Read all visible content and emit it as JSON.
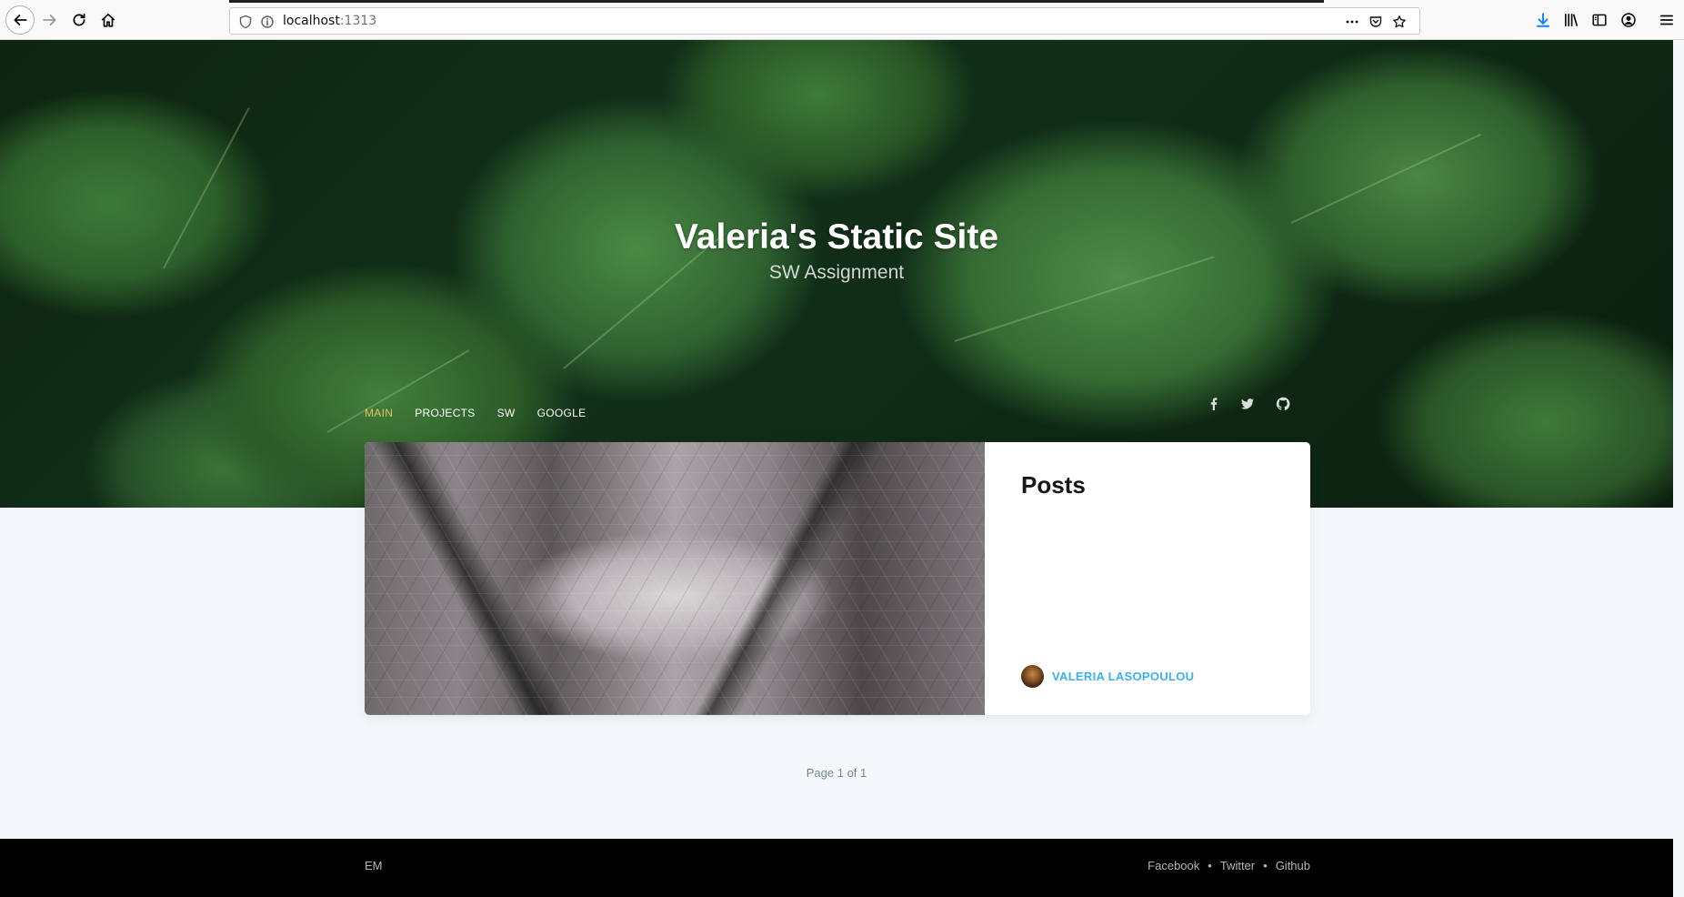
{
  "browser": {
    "url_host": "localhost",
    "url_port": ":1313",
    "icons": [
      "back-icon",
      "forward-icon",
      "reload-icon",
      "home-icon",
      "shield-icon",
      "info-icon",
      "more-icon",
      "pocket-icon",
      "bookmark-star-icon",
      "download-icon",
      "library-icon",
      "sidebar-icon",
      "account-icon",
      "menu-icon"
    ]
  },
  "header": {
    "title": "Valeria's Static Site",
    "subtitle": "SW Assignment"
  },
  "nav": {
    "items": [
      {
        "label": "MAIN",
        "active": true
      },
      {
        "label": "PROJECTS",
        "active": false
      },
      {
        "label": "SW",
        "active": false
      },
      {
        "label": "GOOGLE",
        "active": false
      }
    ],
    "social_icons": [
      "facebook-icon",
      "twitter-icon",
      "github-icon"
    ]
  },
  "post": {
    "title": "Posts",
    "author": "VALERIA LASOPOULOU"
  },
  "pagination": {
    "text": "Page 1 of 1"
  },
  "footer": {
    "brand": "EM",
    "links": [
      "Facebook",
      "Twitter",
      "Github"
    ],
    "separator": "•"
  },
  "colors": {
    "nav_active": "#e3c35f",
    "author_link": "#3eb0ef",
    "page_bg": "#f4f8fb",
    "footer_bg": "#000000"
  }
}
